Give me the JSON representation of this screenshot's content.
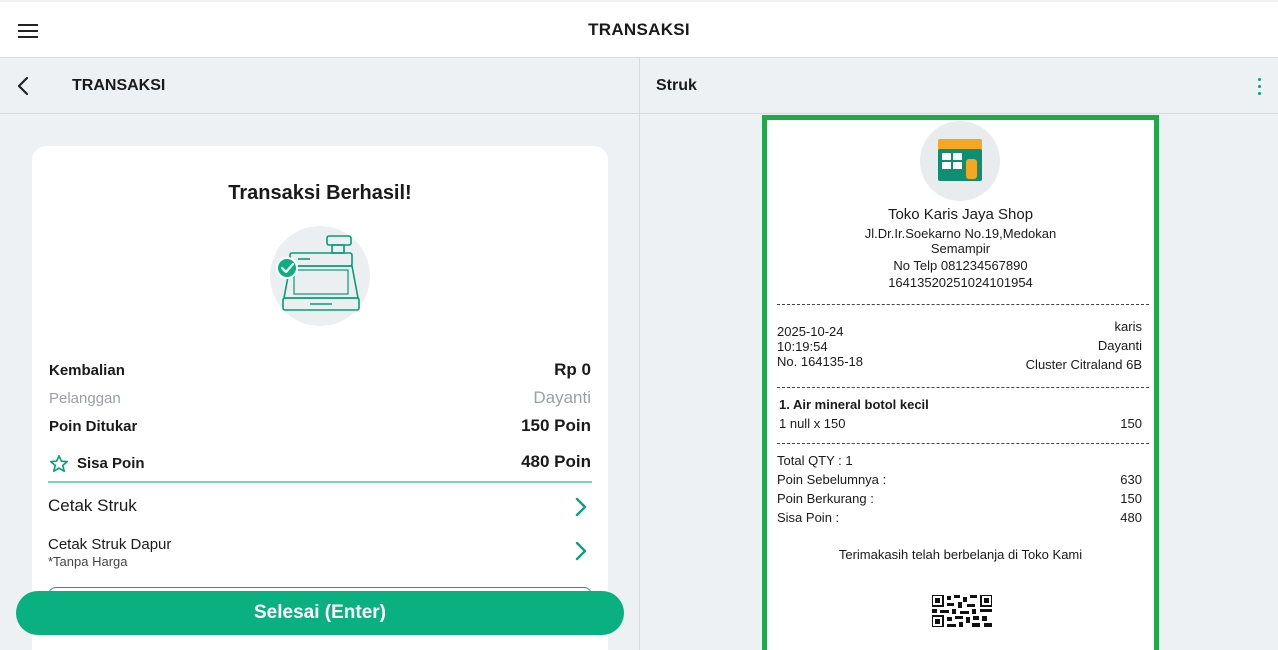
{
  "topbar": {
    "title": "TRANSAKSI"
  },
  "left": {
    "header": {
      "title": "TRANSAKSI"
    },
    "card": {
      "title": "Transaksi Berhasil!",
      "rows": {
        "kembalian": {
          "label": "Kembalian",
          "value": "Rp 0"
        },
        "pelanggan": {
          "label": "Pelanggan",
          "value": "Dayanti"
        },
        "poin_ditukar": {
          "label": "Poin Ditukar",
          "value": "150 Poin"
        },
        "sisa_poin": {
          "label": "Sisa Poin",
          "value": "480 Poin"
        }
      },
      "menu": {
        "cetak_struk": {
          "label": "Cetak Struk"
        },
        "cetak_dapur": {
          "label": "Cetak Struk Dapur",
          "sub": "*Tanpa Harga"
        }
      }
    },
    "done_button": "Selesai (Enter)"
  },
  "right": {
    "header": {
      "title": "Struk"
    },
    "receipt": {
      "shop_name": "Toko Karis Jaya Shop",
      "address_line1": "Jl.Dr.Ir.Soekarno No.19,Medokan",
      "address_line2": "Semampir",
      "phone": "No Telp 081234567890",
      "shop_id": "16413520251024101954",
      "date": "2025-10-24",
      "time": "10:19:54",
      "number": "No. 164135-18",
      "cashier": "karis",
      "customer": "Dayanti",
      "location": "Cluster Citraland 6B",
      "items": [
        {
          "name": "1. Air mineral botol kecil",
          "detail": "1 null x 150",
          "total": "150"
        }
      ],
      "total_qty": "Total QTY : 1",
      "poin_sebelumnya": {
        "label": "Poin Sebelumnya :",
        "value": "630"
      },
      "poin_berkurang": {
        "label": "Poin Berkurang :",
        "value": "150"
      },
      "sisa_poin": {
        "label": "Sisa Poin :",
        "value": "480"
      },
      "thanks": "Terimakasih telah berbelanja di Toko Kami"
    }
  },
  "colors": {
    "accent": "#0ab07f",
    "receipt_border": "#22a84a",
    "background": "#eef1f4"
  },
  "icons": [
    "menu-icon",
    "back-icon",
    "more-vertical-icon",
    "cash-register-check-icon",
    "star-icon",
    "chevron-right-icon",
    "shop-logo-icon",
    "qr-code-icon"
  ]
}
